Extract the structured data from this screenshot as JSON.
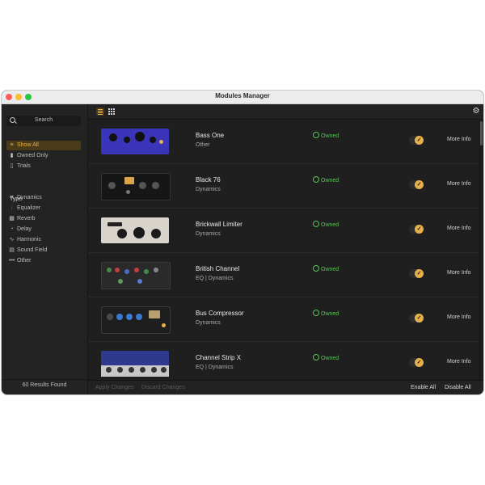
{
  "window": {
    "title": "Modules Manager"
  },
  "sidebar": {
    "search_label": "Search",
    "filters": [
      {
        "label": "Show All",
        "icon": "list-icon"
      },
      {
        "label": "Owned Only",
        "icon": "bookmark-icon"
      },
      {
        "label": "Trials",
        "icon": "document-icon"
      }
    ],
    "type_heading": "Type",
    "types": [
      {
        "label": "Dynamics",
        "icon": "dynamics-icon"
      },
      {
        "label": "Equalizer",
        "icon": "equalizer-icon"
      },
      {
        "label": "Reverb",
        "icon": "reverb-icon"
      },
      {
        "label": "Delay",
        "icon": "delay-icon"
      },
      {
        "label": "Harmonic",
        "icon": "harmonic-icon"
      },
      {
        "label": "Sound Field",
        "icon": "sound-field-icon"
      },
      {
        "label": "Other",
        "icon": "more-icon"
      }
    ],
    "results_text": "60 Results Found"
  },
  "toolbar": {
    "list_view": "list-view-icon",
    "grid_view": "grid-view-icon",
    "settings": "gear-icon"
  },
  "modules": [
    {
      "name": "Bass One",
      "category": "Other",
      "status": "Owned",
      "more": "More Info",
      "thumb_color": "#3a34b8",
      "enabled": true
    },
    {
      "name": "Black 76",
      "category": "Dynamics",
      "status": "Owned",
      "more": "More Info",
      "thumb_color": "#161616",
      "enabled": true
    },
    {
      "name": "Brickwall Limiter",
      "category": "Dynamics",
      "status": "Owned",
      "more": "More Info",
      "thumb_color": "#d8d4cc",
      "enabled": true
    },
    {
      "name": "British Channel",
      "category": "EQ | Dynamics",
      "status": "Owned",
      "more": "More Info",
      "thumb_color": "#2a2a2a",
      "enabled": true
    },
    {
      "name": "Bus Compressor",
      "category": "Dynamics",
      "status": "Owned",
      "more": "More Info",
      "thumb_color": "#1e1e1e",
      "enabled": true
    },
    {
      "name": "Channel Strip X",
      "category": "EQ | Dynamics",
      "status": "Owned",
      "more": "More Info",
      "thumb_color": "#2e3a8e",
      "enabled": true
    }
  ],
  "footer": {
    "apply": "Apply Changes",
    "discard": "Discard Changes",
    "enable_all": "Enable All",
    "disable_all": "Disable All"
  },
  "colors": {
    "accent": "#e6b14b",
    "owned": "#5cc25c",
    "background": "#1d1d1d"
  }
}
